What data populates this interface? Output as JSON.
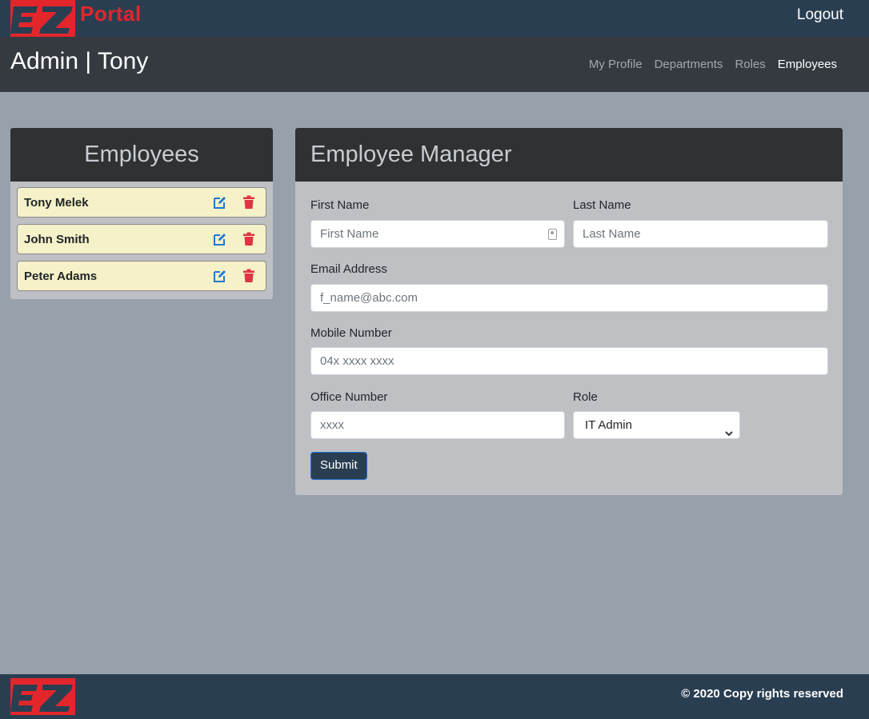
{
  "header": {
    "logo_text": "Portal",
    "logout_label": "Logout"
  },
  "navbar": {
    "title": "Admin | Tony",
    "links": [
      {
        "label": "My Profile",
        "active": false
      },
      {
        "label": "Departments",
        "active": false
      },
      {
        "label": "Roles",
        "active": false
      },
      {
        "label": "Employees",
        "active": true
      }
    ]
  },
  "employees_panel": {
    "title": "Employees",
    "items": [
      {
        "name": "Tony Melek"
      },
      {
        "name": "John Smith"
      },
      {
        "name": "Peter Adams"
      }
    ]
  },
  "manager": {
    "title": "Employee Manager",
    "first_name": {
      "label": "First Name",
      "placeholder": "First Name",
      "value": ""
    },
    "last_name": {
      "label": "Last Name",
      "placeholder": "Last Name",
      "value": ""
    },
    "email": {
      "label": "Email Address",
      "placeholder": "f_name@abc.com",
      "value": ""
    },
    "mobile": {
      "label": "Mobile Number",
      "placeholder": "04x xxxx xxxx",
      "value": ""
    },
    "office": {
      "label": "Office Number",
      "placeholder": "xxxx",
      "value": ""
    },
    "role": {
      "label": "Role",
      "selected": "IT Admin"
    },
    "submit_label": "Submit"
  },
  "footer": {
    "copyright": "© 2020 Copy rights reserved"
  },
  "colors": {
    "brand_red": "#e3262c",
    "header_navy": "#2a3e52",
    "edit_blue": "#1f78d1",
    "delete_red": "#dc3545"
  }
}
